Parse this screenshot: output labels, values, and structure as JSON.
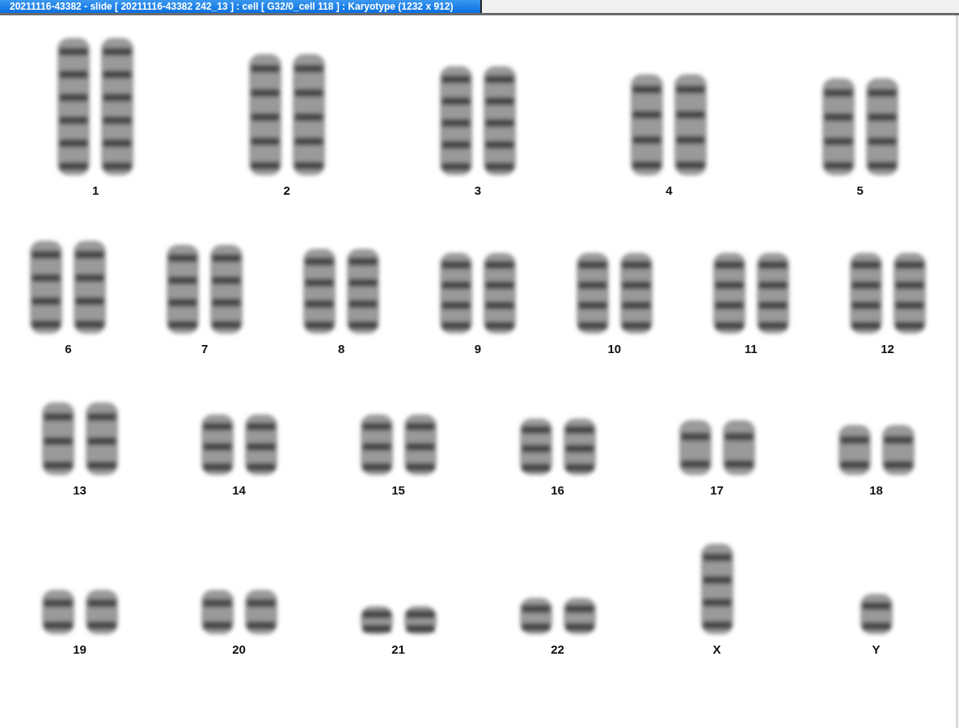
{
  "window": {
    "title": "20211116-43382 - slide [ 20211116-43382 242_13 ] : cell [ G32/0_cell 118 ] : Karyotype  (1232 x 912)"
  },
  "karyotype": {
    "rows": [
      {
        "pairs": [
          {
            "label": "1",
            "kind": "pair"
          },
          {
            "label": "2",
            "kind": "pair"
          },
          {
            "label": "3",
            "kind": "pair"
          },
          {
            "label": "4",
            "kind": "pair"
          },
          {
            "label": "5",
            "kind": "pair"
          }
        ]
      },
      {
        "pairs": [
          {
            "label": "6",
            "kind": "pair"
          },
          {
            "label": "7",
            "kind": "pair"
          },
          {
            "label": "8",
            "kind": "pair"
          },
          {
            "label": "9",
            "kind": "pair"
          },
          {
            "label": "10",
            "kind": "pair"
          },
          {
            "label": "11",
            "kind": "pair"
          },
          {
            "label": "12",
            "kind": "pair"
          }
        ]
      },
      {
        "pairs": [
          {
            "label": "13",
            "kind": "pair"
          },
          {
            "label": "14",
            "kind": "pair"
          },
          {
            "label": "15",
            "kind": "pair"
          },
          {
            "label": "16",
            "kind": "pair"
          },
          {
            "label": "17",
            "kind": "pair"
          },
          {
            "label": "18",
            "kind": "pair"
          }
        ]
      },
      {
        "pairs": [
          {
            "label": "19",
            "kind": "pair"
          },
          {
            "label": "20",
            "kind": "pair"
          },
          {
            "label": "21",
            "kind": "pair"
          },
          {
            "label": "22",
            "kind": "pair"
          },
          {
            "label": "X",
            "kind": "single"
          },
          {
            "label": "Y",
            "kind": "single"
          }
        ]
      }
    ]
  }
}
